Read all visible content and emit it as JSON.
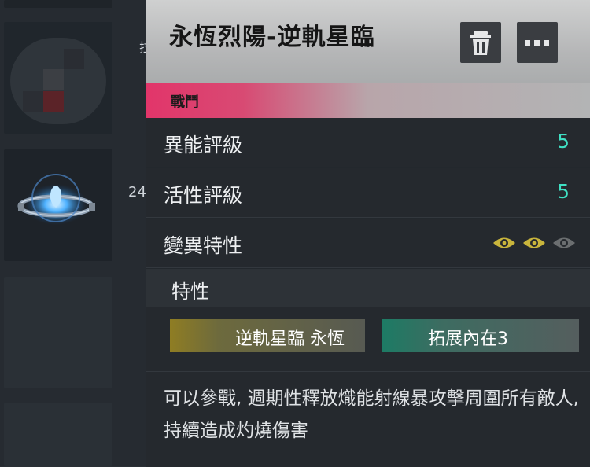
{
  "inventory": {
    "side_chip": "拉",
    "side_number": "24"
  },
  "item": {
    "title": "永恆烈陽-逆軌星臨",
    "category_tag": "戰鬥"
  },
  "stats": [
    {
      "label": "異能評級",
      "value": "5"
    },
    {
      "label": "活性評級",
      "value": "5"
    },
    {
      "label": "變異特性",
      "eyes_filled": 2,
      "eyes_total": 3
    }
  ],
  "traits_section": {
    "title": "特性",
    "items": [
      {
        "label": "逆軌星臨 永恆",
        "color": "#8f7d23"
      },
      {
        "label": "拓展內在3",
        "color": "#1d7b64"
      }
    ]
  },
  "description": "可以參戰, 週期性釋放熾能射線暴攻擊周圍所有敵人, 持續造成灼燒傷害",
  "colors": {
    "accent": "#3fe0c3",
    "tag": "#e2356a",
    "eye_on": "#c9b53c",
    "eye_off": "#6b6e70"
  }
}
